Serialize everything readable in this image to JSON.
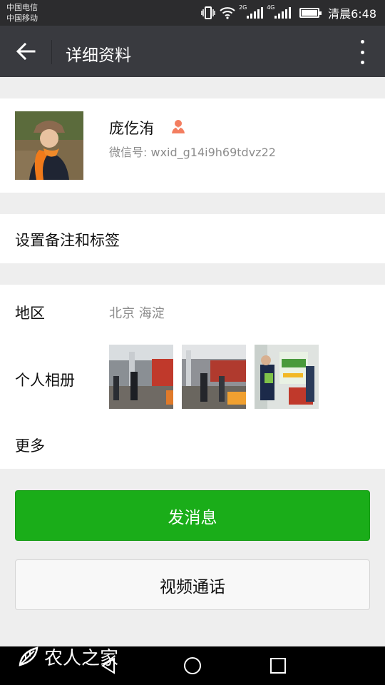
{
  "status_bar": {
    "carrier_1": "中国电信",
    "carrier_2": "中国移动",
    "network_1": "2G",
    "network_2": "4G",
    "time": "清晨6:48"
  },
  "header": {
    "title": "详细资料",
    "back_icon": "arrow-left-icon",
    "more_icon": "more-vertical-icon"
  },
  "profile": {
    "name": "庞仡洧",
    "wechat_id": "微信号: wxid_g14i9h69tdvz22",
    "gender_icon": "female-icon",
    "gender_color": "#f37e60"
  },
  "remark_row": {
    "label": "设置备注和标签"
  },
  "region": {
    "label": "地区",
    "value": "北京  海淀"
  },
  "album": {
    "label": "个人相册",
    "photos": [
      "exhibition-hall-photo",
      "exhibition-hall-photo",
      "exhibition-stand-photo"
    ]
  },
  "more_row": {
    "label": "更多"
  },
  "buttons": {
    "send_message": "发消息",
    "video_call": "视频通话"
  },
  "colors": {
    "primary_green": "#1aad19",
    "title_bar": "#393a3f"
  },
  "watermark": {
    "text": "农人之家"
  }
}
